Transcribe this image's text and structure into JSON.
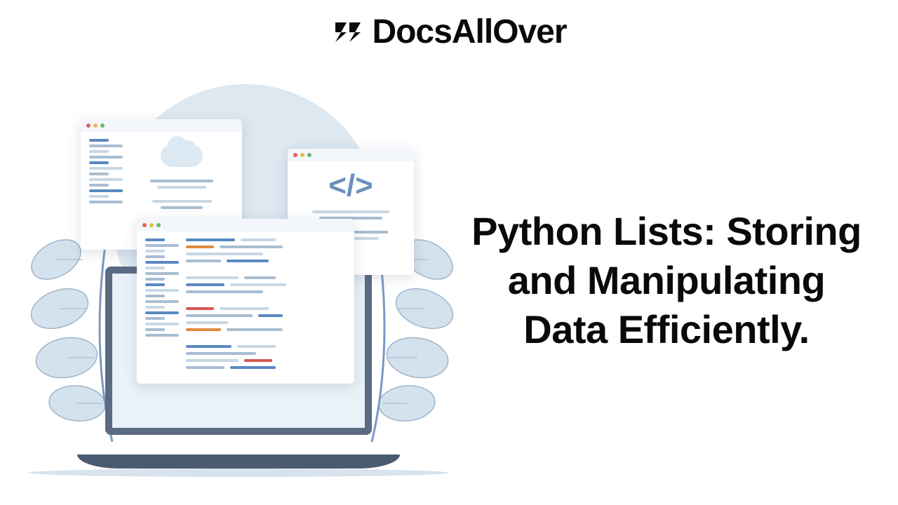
{
  "brand": "DocsAllOver",
  "title": "Python Lists: Storing and Manipulating Data Efficiently.",
  "code_symbol": "</>"
}
